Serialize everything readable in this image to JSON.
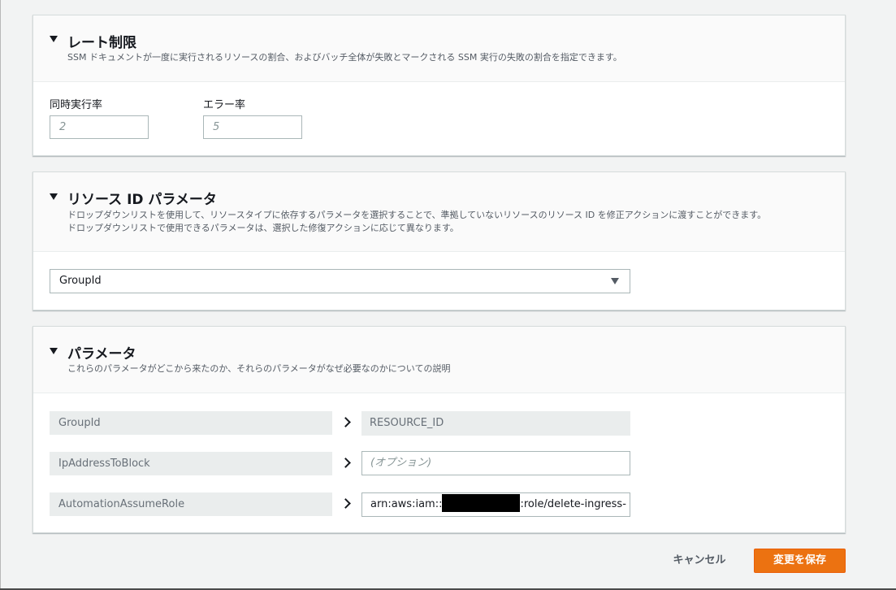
{
  "rate_limit": {
    "title": "レート制限",
    "description": "SSM ドキュメントが一度に実行されるリソースの割合、およびバッチ全体が失敗とマークされる SSM 実行の失敗の割合を指定できます。",
    "concurrency_label": "同時実行率",
    "concurrency_placeholder": "2",
    "error_label": "エラー率",
    "error_placeholder": "5"
  },
  "resource_id": {
    "title": "リソース ID パラメータ",
    "description_line1": "ドロップダウンリストを使用して、リソースタイプに依存するパラメータを選択することで、準拠していないリソースのリソース ID を修正アクションに渡すことができます。",
    "description_line2": "ドロップダウンリストで使用できるパラメータは、選択した修復アクションに応じて異なります。",
    "selected": "GroupId"
  },
  "parameters": {
    "title": "パラメータ",
    "description": "これらのパラメータがどこから来たのか、それらのパラメータがなぜ必要なのかについての説明",
    "rows": [
      {
        "name": "GroupId",
        "value": "RESOURCE_ID"
      },
      {
        "name": "IpAddressToBlock",
        "placeholder": "(オプション)"
      },
      {
        "name": "AutomationAssumeRole",
        "value_prefix": "arn:aws:iam::",
        "value_suffix": ":role/delete-ingress-"
      }
    ]
  },
  "actions": {
    "cancel_label": "キャンセル",
    "save_label": "変更を保存"
  },
  "colors": {
    "primary_button": "#ec7211",
    "background": "#f2f3f3"
  }
}
